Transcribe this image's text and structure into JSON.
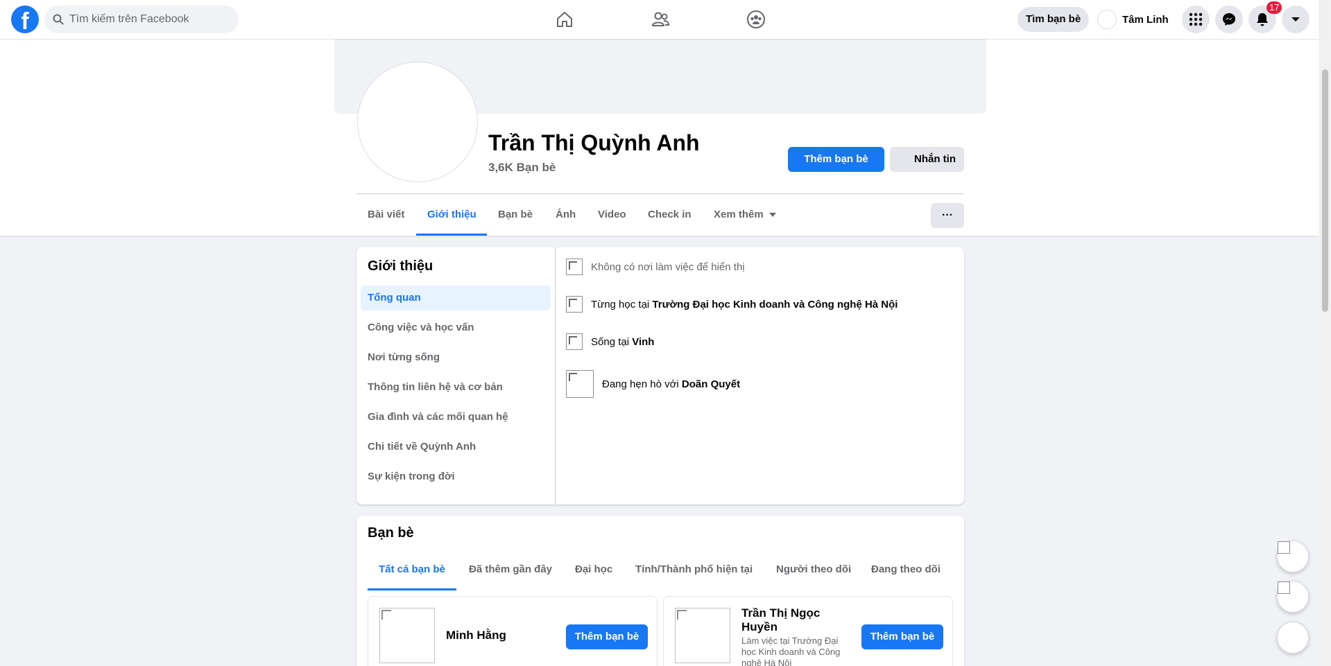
{
  "topbar": {
    "logo_glyph": "f",
    "search_placeholder": "Tìm kiếm trên Facebook",
    "nav_icons": [
      "home-icon",
      "friends-icon",
      "groups-icon"
    ],
    "find_friends_label": "Tìm bạn bè",
    "user_name": "Tâm Linh",
    "notifications_count": "17",
    "brand_color": "#1877f2"
  },
  "profile": {
    "name": "Trần Thị Quỳnh Anh",
    "friends_count": "3,6K Bạn bè",
    "add_friend_label": "Thêm bạn bè",
    "message_label": "Nhắn tin",
    "more_label": "···",
    "tabs": [
      {
        "label": "Bài viết"
      },
      {
        "label": "Giới thiệu",
        "active": true
      },
      {
        "label": "Bạn bè"
      },
      {
        "label": "Ảnh"
      },
      {
        "label": "Video"
      },
      {
        "label": "Check in"
      },
      {
        "label": "Xem thêm"
      }
    ]
  },
  "intro": {
    "title": "Giới thiệu",
    "nav": [
      {
        "label": "Tổng quan",
        "active": true
      },
      {
        "label": "Công việc và học vấn"
      },
      {
        "label": "Nơi từng sống"
      },
      {
        "label": "Thông tin liên hệ và cơ bản"
      },
      {
        "label": "Gia đình và các mối quan hệ"
      },
      {
        "label": "Chi tiết về Quỳnh Anh"
      },
      {
        "label": "Sự kiện trong đời"
      }
    ],
    "work_text": "Không có nơi làm việc để hiển thị",
    "study_prefix": "Từng học tại ",
    "study_school": "Trường Đại học Kinh doanh và Công nghệ Hà Nội",
    "lives_prefix": "Sống tại ",
    "lives_city": "Vinh",
    "dating_prefix": "Đang hẹn hò với ",
    "dating_partner": "Doãn Quyết"
  },
  "friends": {
    "title": "Bạn bè",
    "tabs": [
      {
        "label": "Tất cả bạn bè",
        "active": true
      },
      {
        "label": "Đã thêm gần đây"
      },
      {
        "label": "Đại học"
      },
      {
        "label": "Tỉnh/Thành phố hiện tại"
      },
      {
        "label": "Người theo dõi"
      },
      {
        "label": "Đang theo dõi"
      }
    ],
    "items": [
      {
        "name": "Minh Hằng",
        "subtitle": "",
        "button": "Thêm bạn bè"
      },
      {
        "name": "Trần Thị Ngọc Huyền",
        "subtitle": "Làm việc tại Trường Đại học Kinh doanh và Công nghệ Hà Nội",
        "button": "Thêm bạn bè"
      }
    ]
  }
}
